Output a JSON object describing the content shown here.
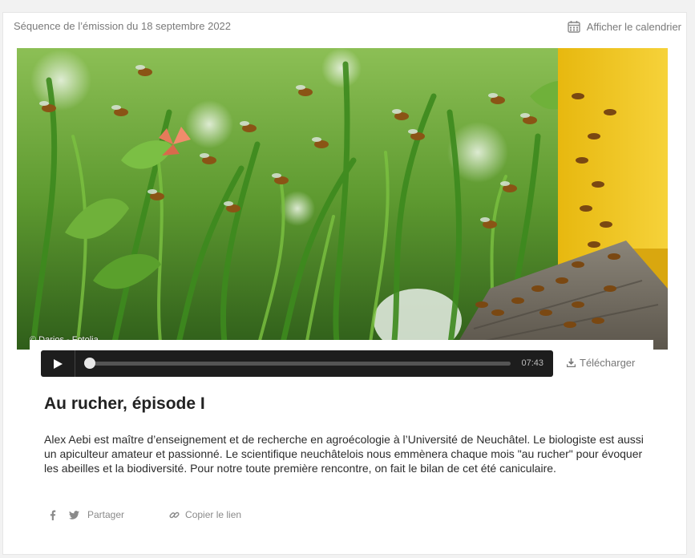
{
  "header": {
    "sequence_label": "Séquence de l’émission du 18 septembre 2022",
    "calendar_label": "Afficher le calendrier"
  },
  "image": {
    "credit": "© Darios - Fotolia"
  },
  "player": {
    "duration": "07:43",
    "progress": 0
  },
  "download_label": "Télécharger",
  "episode": {
    "title": "Au rucher, épisode I",
    "description": "Alex Aebi est maître d’enseignement et de recherche en agroécologie à l’Université de Neuchâtel. Le biologiste est aussi un apiculteur amateur et passionné. Le scientifique neuchâtelois nous emmènera chaque mois \"au rucher\" pour évoquer les abeilles et la biodiversité. Pour notre toute première rencontre, on fait le bilan de cet été caniculaire."
  },
  "share": {
    "share_label": "Partager",
    "copy_link_label": "Copier le lien"
  },
  "colors": {
    "player_bg": "#1d1d1d",
    "hive_yellow": "#f2c31a",
    "grass_green": "#4f9a2c"
  }
}
